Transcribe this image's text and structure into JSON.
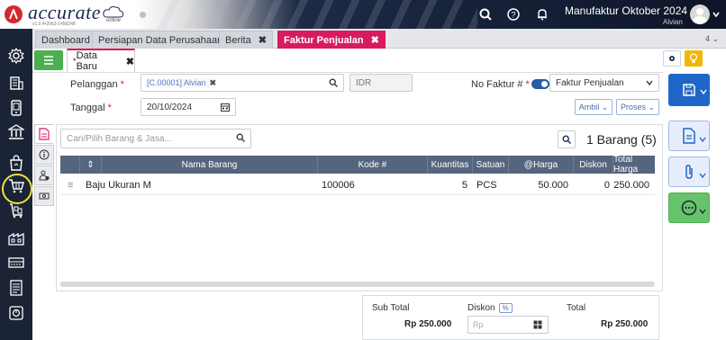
{
  "app": {
    "logo_text": "accurate",
    "logo_sub": "online",
    "version": "v1.0.4•2063-1456248",
    "company": "Manufaktur Oktober 2024",
    "username": "Alvian"
  },
  "tabs": [
    {
      "label": "Dashboard",
      "closable": false,
      "active": false
    },
    {
      "label": "Persiapan Data Perusahaan",
      "closable": false,
      "active": false
    },
    {
      "label": "Berita",
      "closable": true,
      "active": false
    },
    {
      "label": "Faktur Penjualan",
      "closable": true,
      "active": true
    }
  ],
  "tab_count": "4",
  "subtab": {
    "label": "Data Baru",
    "modified_marker": "*"
  },
  "form": {
    "pelanggan_label": "Pelanggan",
    "pelanggan_chip": "[C.00001] Alvian",
    "currency": "IDR",
    "no_faktur_label": "No Faktur #",
    "no_faktur_select": "Faktur Penjualan",
    "tanggal_label": "Tanggal",
    "tanggal_value": "20/10/2024",
    "ambil_label": "Ambil",
    "proses_label": "Proses",
    "required_marker": "*"
  },
  "items": {
    "search_placeholder": "Cari/Pilih Barang & Jasa...",
    "count_label": "1 Barang (5)",
    "columns": [
      "Nama Barang",
      "Kode #",
      "Kuantitas",
      "Satuan",
      "@Harga",
      "Diskon",
      "Total Harga"
    ],
    "rows": [
      {
        "nama": "Baju Ukuran M",
        "kode": "100006",
        "kuantitas": "5",
        "satuan": "PCS",
        "harga": "50.000",
        "diskon": "0",
        "total": "250.000"
      }
    ]
  },
  "totals": {
    "sub_total_label": "Sub Total",
    "sub_total_value": "Rp 250.000",
    "diskon_label": "Diskon",
    "diskon_badge": "%",
    "diskon_placeholder": "Rp",
    "total_label": "Total",
    "total_value": "Rp 250.000"
  },
  "colors": {
    "brand_red": "#d7262d",
    "accent_pink": "#d81b60",
    "sidebar_bg": "#1b2436",
    "save_blue": "#1e66c9",
    "more_green": "#4caf50",
    "highlight_yellow": "#f2e13a"
  },
  "icons": {
    "sidebar": [
      "gear-icon",
      "building-icon",
      "phone-icon",
      "bank-icon",
      "shopping-bag-icon",
      "cart-icon",
      "trolley-icon",
      "factory-icon",
      "cash-register-icon",
      "ledger-icon",
      "report-icon"
    ],
    "top": [
      "search-icon",
      "help-icon",
      "bell-icon"
    ]
  }
}
